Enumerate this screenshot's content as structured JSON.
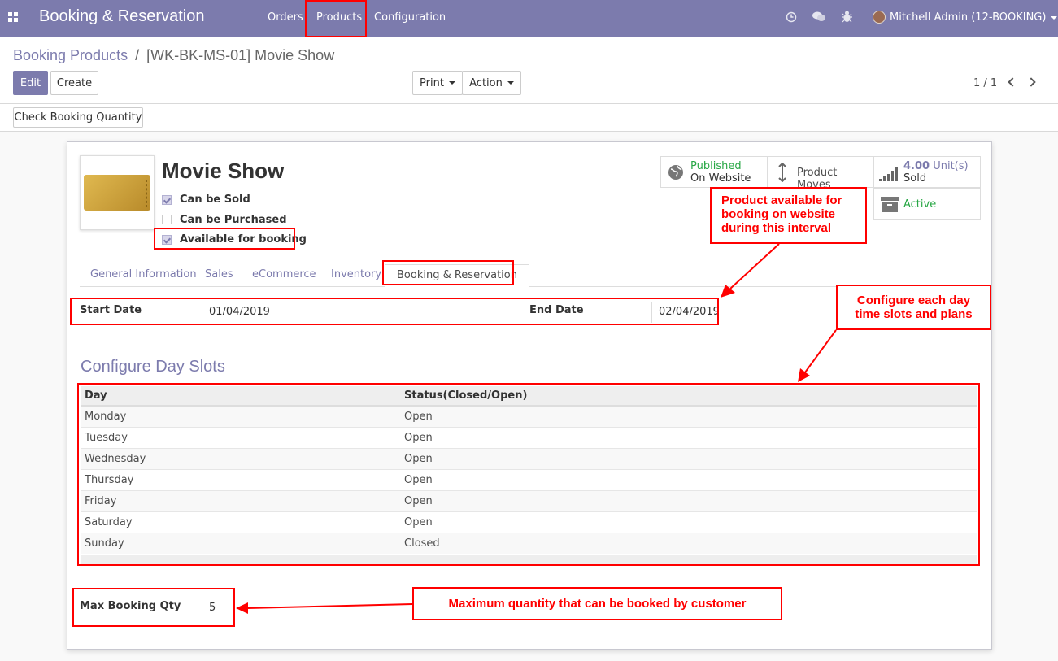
{
  "navbar": {
    "brand": "Booking & Reservation",
    "menu": [
      "Orders",
      "Products",
      "Configuration"
    ],
    "user": "Mitchell Admin (12-BOOKING)"
  },
  "breadcrumb": {
    "parent": "Booking Products",
    "separator": "/",
    "current": "[WK-BK-MS-01] Movie Show"
  },
  "buttons": {
    "edit": "Edit",
    "create": "Create",
    "print": "Print",
    "action": "Action",
    "check_qty": "Check Booking Quantity"
  },
  "pager": "1 / 1",
  "product": {
    "name": "Movie Show",
    "checkboxes": [
      {
        "label": "Can be Sold",
        "checked": true
      },
      {
        "label": "Can be Purchased",
        "checked": false
      },
      {
        "label": "Available for booking",
        "checked": true
      }
    ]
  },
  "smart_buttons": {
    "published": {
      "line1": "Published",
      "line2": "On Website"
    },
    "moves": "Product Moves",
    "sold": {
      "value": "4.00",
      "unit": "Unit(s)",
      "label": "Sold"
    },
    "active": "Active"
  },
  "tabs": [
    "General Information",
    "Sales",
    "eCommerce",
    "Inventory",
    "Booking & Reservation"
  ],
  "dates": {
    "start_label": "Start Date",
    "start_value": "01/04/2019",
    "end_label": "End Date",
    "end_value": "02/04/2019"
  },
  "day_slots": {
    "title": "Configure Day Slots",
    "headers": [
      "Day",
      "Status(Closed/Open)"
    ],
    "rows": [
      [
        "Monday",
        "Open"
      ],
      [
        "Tuesday",
        "Open"
      ],
      [
        "Wednesday",
        "Open"
      ],
      [
        "Thursday",
        "Open"
      ],
      [
        "Friday",
        "Open"
      ],
      [
        "Saturday",
        "Open"
      ],
      [
        "Sunday",
        "Closed"
      ]
    ]
  },
  "max_qty": {
    "label": "Max Booking Qty",
    "value": "5"
  },
  "annotations": {
    "website": [
      "Product available for",
      "booking on website",
      "during this interval"
    ],
    "slots": [
      "Configure each day",
      "time slots and plans"
    ],
    "max_qty": "Maximum quantity that can be booked by customer"
  },
  "colors": {
    "brand": "#7c7bad",
    "annotation": "#ff0000",
    "published": "#28a745"
  }
}
